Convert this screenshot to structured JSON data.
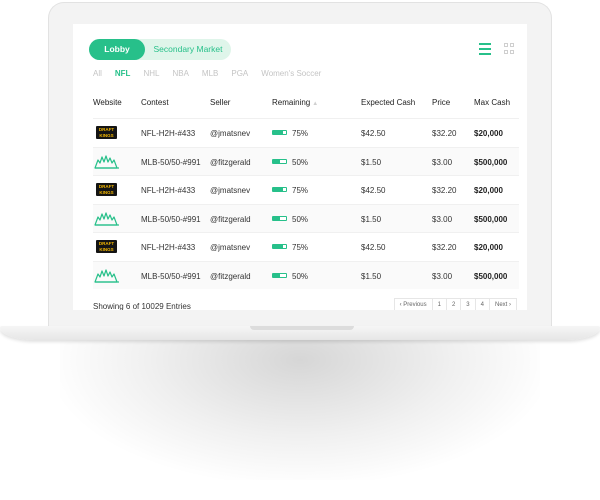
{
  "market_toggle": {
    "lobby": "Lobby",
    "secondary": "Secondary Market"
  },
  "view_icons": [
    "list-icon",
    "grid-icon"
  ],
  "sports": [
    "All",
    "NFL",
    "NHL",
    "NBA",
    "MLB",
    "PGA",
    "Women's Soccer"
  ],
  "active_sport": "NFL",
  "columns": [
    "Website",
    "Contest",
    "Seller",
    "Remaining",
    "Expected Cash",
    "Price",
    "Max Cash"
  ],
  "rows": [
    {
      "website": "DraftKings",
      "logo_text": "DRAFT KINGS",
      "contest": "NFL-H2H-#433",
      "seller": "@jmatsnev",
      "remaining": "75%",
      "remaining_fraction": 0.75,
      "expected": "$42.50",
      "price": "$32.20",
      "max": "$20,000"
    },
    {
      "website": "FanDuel",
      "logo_text": "",
      "contest": "MLB-50/50-#991",
      "seller": "@fitzgerald",
      "remaining": "50%",
      "remaining_fraction": 0.5,
      "expected": "$1.50",
      "price": "$3.00",
      "max": "$500,000"
    },
    {
      "website": "DraftKings",
      "logo_text": "DRAFT KINGS",
      "contest": "NFL-H2H-#433",
      "seller": "@jmatsnev",
      "remaining": "75%",
      "remaining_fraction": 0.75,
      "expected": "$42.50",
      "price": "$32.20",
      "max": "$20,000"
    },
    {
      "website": "FanDuel",
      "logo_text": "",
      "contest": "MLB-50/50-#991",
      "seller": "@fitzgerald",
      "remaining": "50%",
      "remaining_fraction": 0.5,
      "expected": "$1.50",
      "price": "$3.00",
      "max": "$500,000"
    },
    {
      "website": "DraftKings",
      "logo_text": "DRAFT KINGS",
      "contest": "NFL-H2H-#433",
      "seller": "@jmatsnev",
      "remaining": "75%",
      "remaining_fraction": 0.75,
      "expected": "$42.50",
      "price": "$32.20",
      "max": "$20,000"
    },
    {
      "website": "FanDuel",
      "logo_text": "",
      "contest": "MLB-50/50-#991",
      "seller": "@fitzgerald",
      "remaining": "50%",
      "remaining_fraction": 0.5,
      "expected": "$1.50",
      "price": "$3.00",
      "max": "$500,000"
    }
  ],
  "footer": {
    "entries_text": "Showing 6 of 10029 Entries",
    "pagination": [
      "Previous",
      "1",
      "2",
      "3",
      "4",
      "Next"
    ]
  },
  "colors": {
    "accent": "#27c08a",
    "accent_light": "#dff5ea",
    "muted": "#c4c4c4"
  }
}
